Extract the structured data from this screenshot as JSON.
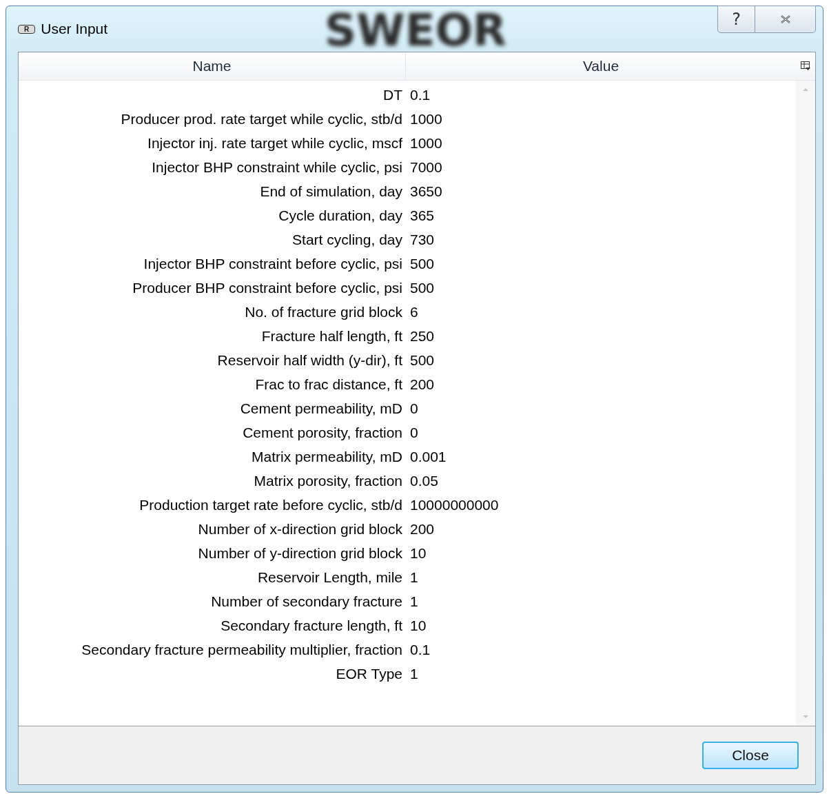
{
  "window": {
    "title": "User Input",
    "app_badge": "R",
    "backdrop_text": "SWEOR",
    "help_button": "?"
  },
  "table": {
    "columns": [
      "Name",
      "Value"
    ],
    "rows": [
      {
        "name": "DT",
        "value": "0.1"
      },
      {
        "name": "Producer prod. rate target while cyclic, stb/d",
        "value": "1000"
      },
      {
        "name": "Injector inj. rate target while cyclic, mscf",
        "value": "1000"
      },
      {
        "name": "Injector BHP constraint while cyclic, psi",
        "value": "7000"
      },
      {
        "name": "End of simulation, day",
        "value": "3650"
      },
      {
        "name": "Cycle duration, day",
        "value": "365"
      },
      {
        "name": "Start cycling, day",
        "value": "730"
      },
      {
        "name": "Injector BHP constraint before cyclic, psi",
        "value": "500"
      },
      {
        "name": "Producer BHP constraint before cyclic, psi",
        "value": "500"
      },
      {
        "name": "No. of fracture grid block",
        "value": "6"
      },
      {
        "name": "Fracture half length, ft",
        "value": "250"
      },
      {
        "name": "Reservoir half width (y-dir), ft",
        "value": "500"
      },
      {
        "name": "Frac to frac distance, ft",
        "value": "200"
      },
      {
        "name": "Cement permeability, mD",
        "value": "0"
      },
      {
        "name": "Cement porosity, fraction",
        "value": "0"
      },
      {
        "name": "Matrix permeability, mD",
        "value": "0.001"
      },
      {
        "name": "Matrix porosity, fraction",
        "value": "0.05"
      },
      {
        "name": "Production target rate before cyclic, stb/d",
        "value": "10000000000"
      },
      {
        "name": "Number of x-direction grid block",
        "value": "200"
      },
      {
        "name": "Number of y-direction grid block",
        "value": "10"
      },
      {
        "name": "Reservoir Length, mile",
        "value": "1"
      },
      {
        "name": "Number of secondary fracture",
        "value": "1"
      },
      {
        "name": "Secondary fracture length, ft",
        "value": "10"
      },
      {
        "name": "Secondary fracture permeability multiplier, fraction",
        "value": "0.1"
      },
      {
        "name": "EOR Type",
        "value": "1"
      }
    ]
  },
  "buttons": [
    "Close"
  ]
}
